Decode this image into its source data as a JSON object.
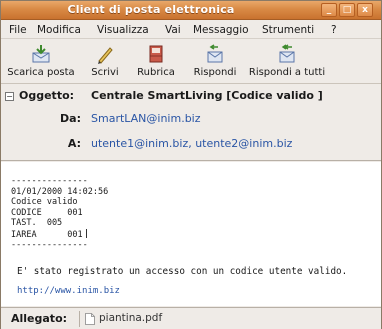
{
  "window": {
    "title": "Client di posta elettronica",
    "controls": {
      "minimize": "_",
      "maximize": "□",
      "close": "x"
    }
  },
  "menu": {
    "items": [
      "File",
      "Modifica",
      "Visualizza",
      "Vai",
      "Messaggio",
      "Strumenti",
      "?"
    ]
  },
  "toolbar": {
    "buttons": [
      {
        "label": "Scarica posta",
        "icon": "download-mail-icon"
      },
      {
        "label": "Scrivi",
        "icon": "compose-pen-icon"
      },
      {
        "label": "Rubrica",
        "icon": "address-book-icon"
      },
      {
        "label": "Rispondi",
        "icon": "reply-icon"
      },
      {
        "label": "Rispondi a tutti",
        "icon": "reply-all-icon"
      }
    ]
  },
  "header": {
    "subject_label": "Oggetto:",
    "subject": "Centrale SmartLiving [Codice valido  ]",
    "from_label": "Da:",
    "from": "SmartLAN@inim.biz",
    "to_label": "A:",
    "to": "utente1@inim.biz, utente2@inim.biz"
  },
  "body": {
    "lines": [
      "---------------",
      "01/01/2000 14:02:56",
      "Codice valido",
      "CODICE     001",
      "TAST.  005",
      "IAREA      001",
      "---------------"
    ],
    "message": "E' stato registrato un accesso con un codice utente valido.",
    "link": "http://www.inim.biz"
  },
  "attachment": {
    "label": "Allegato:",
    "file": "piantina.pdf"
  },
  "colors": {
    "titlebar": "#d98a45",
    "link": "#2a55a5",
    "chrome": "#efebe7"
  }
}
